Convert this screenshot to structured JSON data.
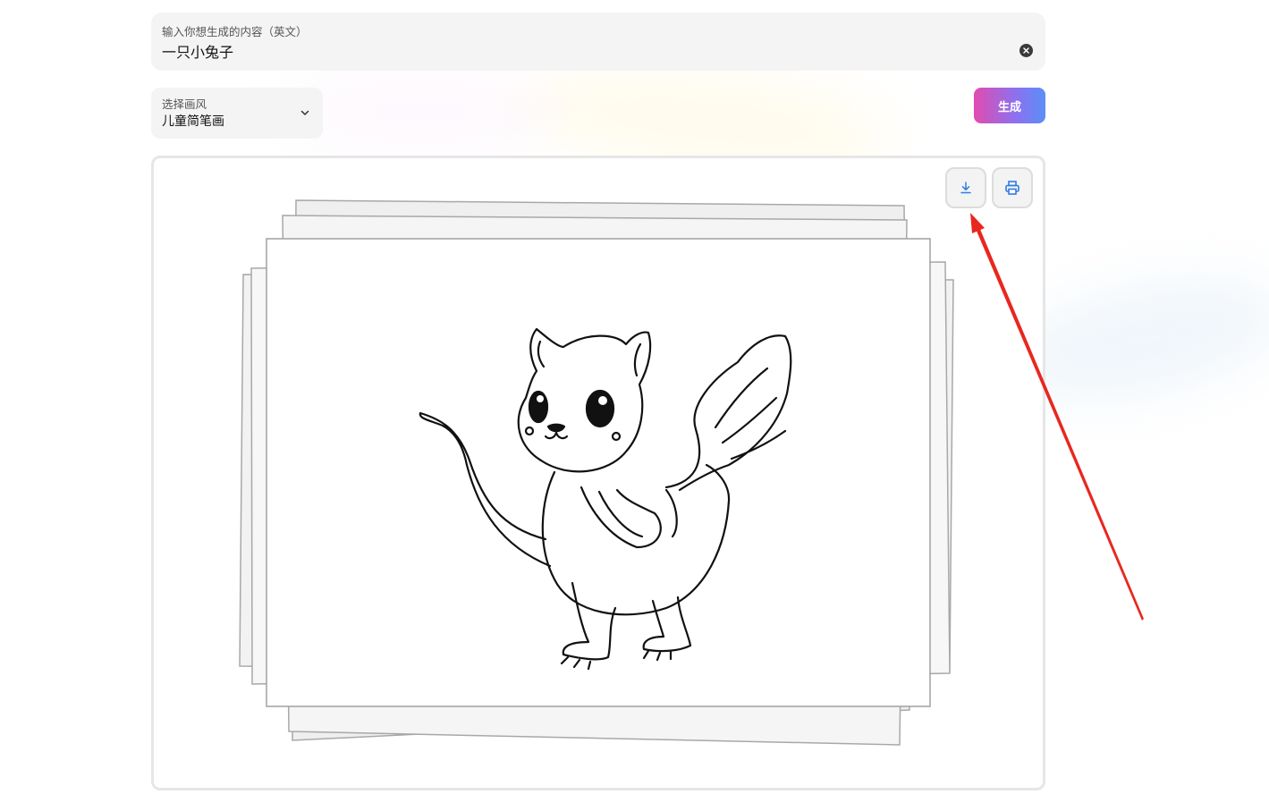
{
  "prompt": {
    "label": "输入你想生成的内容（英文）",
    "value": "一只小兔子"
  },
  "style_select": {
    "label": "选择画风",
    "value": "儿童简笔画"
  },
  "generate_button": {
    "label": "生成"
  },
  "icons": {
    "clear": "close-icon",
    "chevron": "chevron-down-icon",
    "download": "download-icon",
    "print": "printer-icon"
  },
  "colors": {
    "accent_gradient_start": "#e24bb0",
    "accent_gradient_end": "#5b8ff6",
    "icon_blue": "#2f7de1",
    "annotation_red": "#e8271f"
  }
}
